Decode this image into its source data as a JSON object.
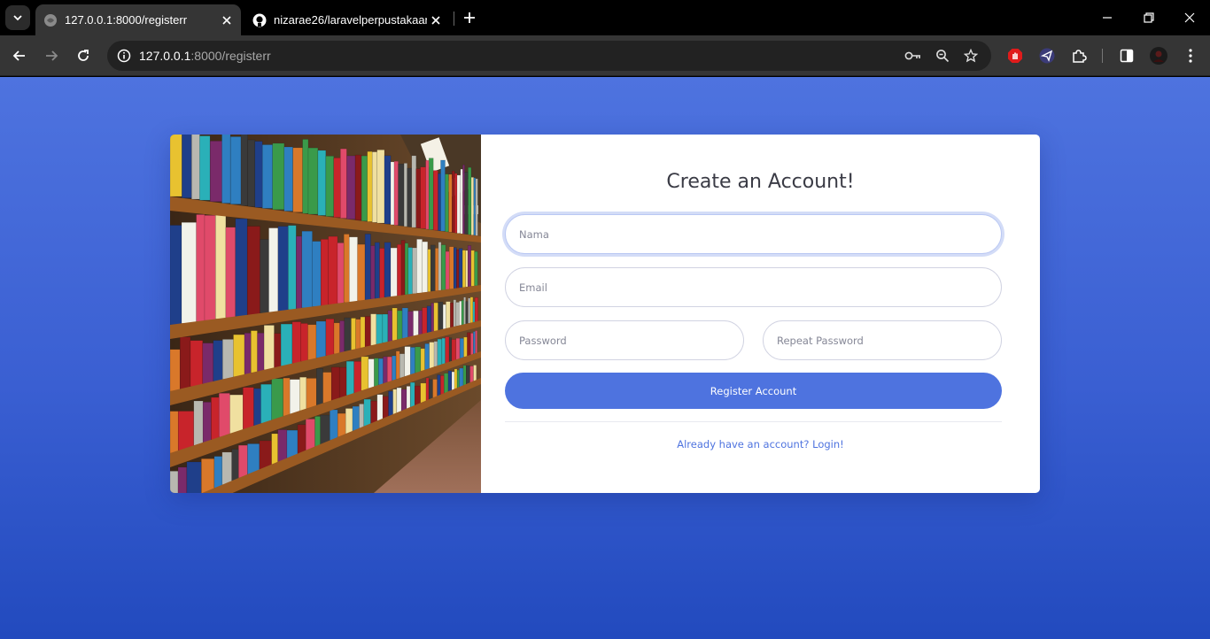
{
  "browser": {
    "tabs": [
      {
        "title": "127.0.0.1:8000/registerr",
        "favicon": "globe-icon",
        "active": true
      },
      {
        "title": "nizarae26/laravelperpustakaan",
        "favicon": "github-icon",
        "active": false
      }
    ],
    "url_host": "127.0.0.1",
    "url_rest": ":8000/registerr",
    "toolbar_icons": [
      "key-icon",
      "zoom-icon",
      "star-icon",
      "adblock-extension-icon",
      "proton-vpn-extension-icon",
      "extensions-icon",
      "side-panel-icon",
      "profile-avatar",
      "menu-icon"
    ]
  },
  "page": {
    "heading": "Create an Account!",
    "fields": {
      "name_placeholder": "Nama",
      "email_placeholder": "Email",
      "password_placeholder": "Password",
      "repeat_password_placeholder": "Repeat Password"
    },
    "register_label": "Register Account",
    "login_link": "Already have an account? Login!"
  },
  "colors": {
    "primary": "#4e73df",
    "background_gradient_end": "#224abe",
    "heading_text": "#3a3b45"
  }
}
